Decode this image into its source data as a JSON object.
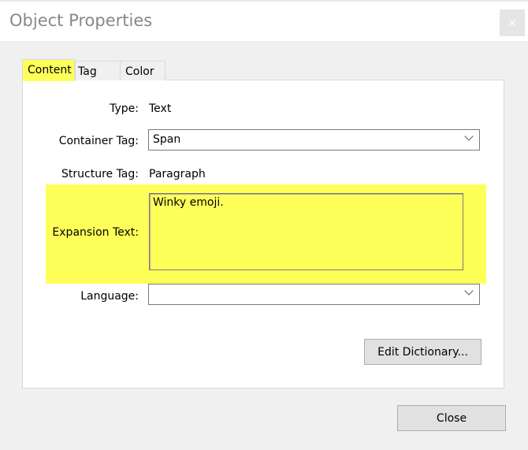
{
  "window": {
    "title": "Object Properties",
    "close_glyph": "×"
  },
  "tabs": [
    {
      "label": "Content",
      "active": true
    },
    {
      "label": "Tag"
    },
    {
      "label": "Color"
    }
  ],
  "content": {
    "type_label": "Type:",
    "type_value": "Text",
    "container_tag_label": "Container Tag:",
    "container_tag_value": "Span",
    "structure_tag_label": "Structure Tag:",
    "structure_tag_value": "Paragraph",
    "expansion_text_label": "Expansion Text:",
    "expansion_text_value": "Winky emoji.",
    "language_label": "Language:",
    "language_value": "",
    "edit_dictionary_label": "Edit Dictionary..."
  },
  "footer": {
    "close_label": "Close"
  },
  "colors": {
    "highlight": "#ffff5a"
  }
}
